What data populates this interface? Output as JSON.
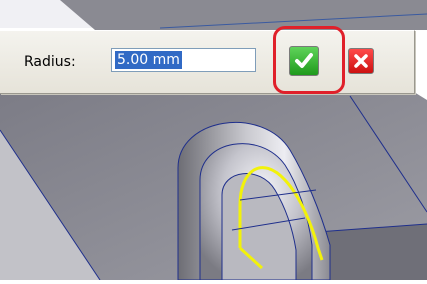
{
  "toolbar": {
    "radius_label": "Radius:",
    "radius_value": "5.00 mm"
  },
  "icons": {
    "ok": "checkmark-icon",
    "cancel": "close-icon"
  },
  "colors": {
    "ok_green": "#2fb52b",
    "cancel_red": "#e01b1b",
    "highlight_red": "#e0202a",
    "selection_blue": "#316ac5",
    "edge_blue": "#1f2f8c",
    "path_yellow": "#f2f20a",
    "model_gray": "#8f8f96"
  }
}
